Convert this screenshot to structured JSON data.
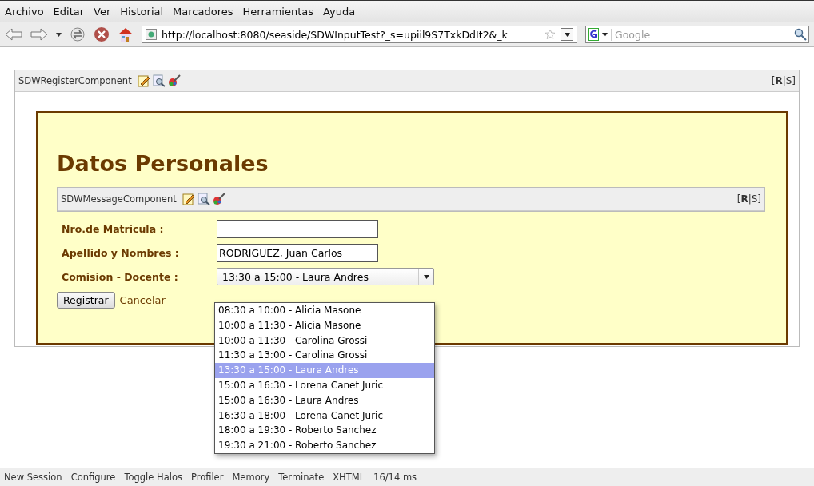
{
  "menu": [
    "Archivo",
    "Editar",
    "Ver",
    "Historial",
    "Marcadores",
    "Herramientas",
    "Ayuda"
  ],
  "toolbar": {
    "url": "http://localhost:8080/seaside/SDWInputTest?_s=upiil9S7TxkDdIt2&_k",
    "search_placeholder": "Google"
  },
  "outer_component": {
    "name": "SDWRegisterComponent",
    "toggle": "[**R**|S]"
  },
  "form": {
    "title": "Datos Personales",
    "message_component": {
      "name": "SDWMessageComponent",
      "toggle": "[**R**|S]"
    },
    "fields": [
      {
        "kind": "text",
        "label": "Nro.de Matricula :"
      },
      {
        "kind": "text",
        "label": "Apellido y Nombres :",
        "value": "RODRIGUEZ, Juan Carlos"
      },
      {
        "kind": "select",
        "label": "Comision - Docente :",
        "value": "13:30 a 15:00 - Laura Andres"
      }
    ],
    "submit": "Registrar",
    "cancel": "Cancelar",
    "dropdown": {
      "expanded": true,
      "options": [
        {
          "label": "08:30 a 10:00 - Alicia Masone",
          "selected": false
        },
        {
          "label": "10:00 a 11:30 - Alicia Masone",
          "selected": false
        },
        {
          "label": "10:00 a 11:30 - Carolina Grossi",
          "selected": false
        },
        {
          "label": "11:30 a 13:00 - Carolina Grossi",
          "selected": false
        },
        {
          "label": "13:30 a 15:00 - Laura Andres",
          "selected": true
        },
        {
          "label": "15:00 a 16:30 - Lorena Canet Juric",
          "selected": false
        },
        {
          "label": "15:00 a 16:30 - Laura Andres",
          "selected": false
        },
        {
          "label": "16:30 a 18:00 - Lorena Canet Juric",
          "selected": false
        },
        {
          "label": "18:00 a 19:30 - Roberto Sanchez",
          "selected": false
        },
        {
          "label": "19:30 a 21:00 - Roberto Sanchez",
          "selected": false
        }
      ]
    }
  },
  "status_bar": [
    "New Session",
    "Configure",
    "Toggle Halos",
    "Profiler",
    "Memory",
    "Terminate",
    "XHTML",
    "16/14 ms"
  ]
}
